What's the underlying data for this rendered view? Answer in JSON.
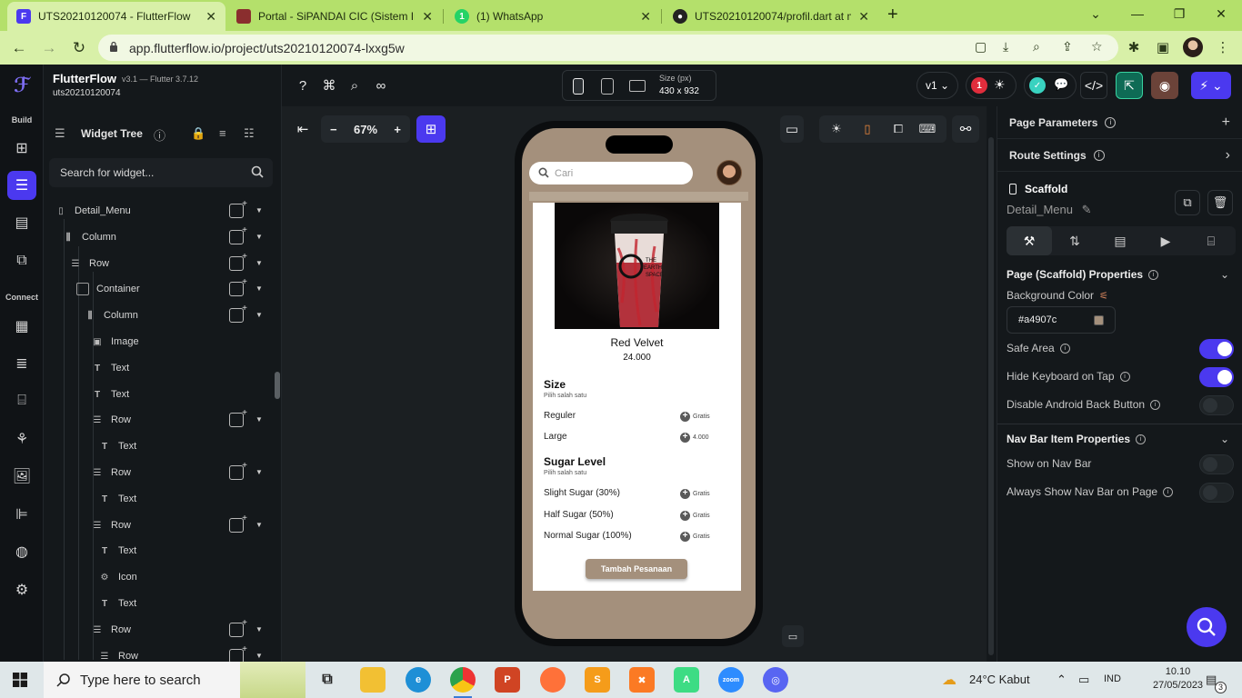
{
  "browser": {
    "tabs": [
      {
        "title": "UTS20210120074 - FlutterFlow",
        "fav_color": "#4b39ef",
        "active": true
      },
      {
        "title": "Portal - SiPANDAI CIC (Sistem Inf",
        "fav_color": "#8a2e2e",
        "active": false
      },
      {
        "title": "(1) WhatsApp",
        "fav_color": "#25d366",
        "active": false
      },
      {
        "title": "UTS20210120074/profil.dart at m",
        "fav_color": "#222222",
        "active": false
      }
    ],
    "new_tab": "+",
    "url": "app.flutterflow.io/project/uts20210120074-lxxg5w",
    "accent": "#b4e06b"
  },
  "app": {
    "brand": "FlutterFlow",
    "version": "v3.1 — Flutter 3.7.12",
    "project": "uts20210120074",
    "rail": {
      "build_label": "Build",
      "connect_label": "Connect"
    },
    "widget_tree": {
      "title": "Widget Tree",
      "search_placeholder": "Search for widget...",
      "nodes": [
        {
          "label": "Detail_Menu",
          "icon": "phone-icon",
          "depth": 0,
          "actions": true
        },
        {
          "label": "Column",
          "icon": "column-icon",
          "depth": 1,
          "actions": true
        },
        {
          "label": "Row",
          "icon": "row-icon",
          "depth": 2,
          "actions": true
        },
        {
          "label": "Container",
          "icon": "container-icon",
          "depth": 3,
          "actions": true
        },
        {
          "label": "Column",
          "icon": "column-icon",
          "depth": 4,
          "actions": true
        },
        {
          "label": "Image",
          "icon": "image-icon",
          "depth": 5,
          "actions": false
        },
        {
          "label": "Text",
          "icon": "text-icon",
          "depth": 5,
          "actions": false
        },
        {
          "label": "Text",
          "icon": "text-icon",
          "depth": 5,
          "actions": false
        },
        {
          "label": "Row",
          "icon": "row-icon",
          "depth": 5,
          "actions": true
        },
        {
          "label": "Text",
          "icon": "text-icon",
          "depth": 6,
          "actions": false
        },
        {
          "label": "Row",
          "icon": "row-icon",
          "depth": 5,
          "actions": true
        },
        {
          "label": "Text",
          "icon": "text-icon",
          "depth": 6,
          "actions": false
        },
        {
          "label": "Row",
          "icon": "row-icon",
          "depth": 5,
          "actions": true
        },
        {
          "label": "Text",
          "icon": "text-icon",
          "depth": 6,
          "actions": false
        },
        {
          "label": "Icon",
          "icon": "gear-icon",
          "depth": 6,
          "actions": false
        },
        {
          "label": "Text",
          "icon": "text-icon",
          "depth": 6,
          "actions": false
        },
        {
          "label": "Row",
          "icon": "row-icon",
          "depth": 5,
          "actions": true
        },
        {
          "label": "Row",
          "icon": "row-icon",
          "depth": 6,
          "actions": true
        }
      ]
    },
    "topbar": {
      "size_label": "Size (px)",
      "size_value": "430 x 932",
      "version": "v1",
      "issues_count": "1"
    },
    "canvas": {
      "zoom": "67%",
      "zoom_minus": "−",
      "zoom_plus": "+"
    },
    "phone": {
      "search_placeholder": "Cari",
      "product_name": "Red Velvet",
      "product_price": "24.000",
      "size_heading": "Size",
      "size_sub": "Pilih salah satu",
      "size_options": [
        {
          "label": "Reguler",
          "price": "Gratis"
        },
        {
          "label": "Large",
          "price": "4.000"
        }
      ],
      "sugar_heading": "Sugar Level",
      "sugar_sub": "Pilih salah satu",
      "sugar_options": [
        {
          "label": "Slight Sugar (30%)",
          "price": "Gratis"
        },
        {
          "label": "Half Sugar (50%)",
          "price": "Gratis"
        },
        {
          "label": "Normal Sugar (100%)",
          "price": "Gratis"
        }
      ],
      "button": "Tambah Pesanaan",
      "cup_text": "THE EARTH SPACE",
      "bg_color": "#a4907c"
    },
    "right_panel": {
      "page_parameters": "Page Parameters",
      "route_settings": "Route Settings",
      "scaffold_title": "Scaffold",
      "scaffold_name": "Detail_Menu",
      "section_page": "Page (Scaffold) Properties",
      "bg_color_label": "Background Color",
      "bg_color_value": "#a4907c",
      "props": [
        {
          "label": "Safe Area",
          "on": true
        },
        {
          "label": "Hide Keyboard on Tap",
          "on": true
        },
        {
          "label": "Disable Android Back Button",
          "on": false
        }
      ],
      "section_nav": "Nav Bar Item Properties",
      "nav_props": [
        {
          "label": "Show on Nav Bar",
          "on": false
        },
        {
          "label": "Always Show Nav Bar on Page",
          "on": false
        }
      ]
    }
  },
  "taskbar": {
    "search_placeholder": "Type here to search",
    "weather": "24°C  Kabut",
    "lang": "IND",
    "time": "10.10",
    "date": "27/05/2023",
    "notif_count": "3"
  }
}
